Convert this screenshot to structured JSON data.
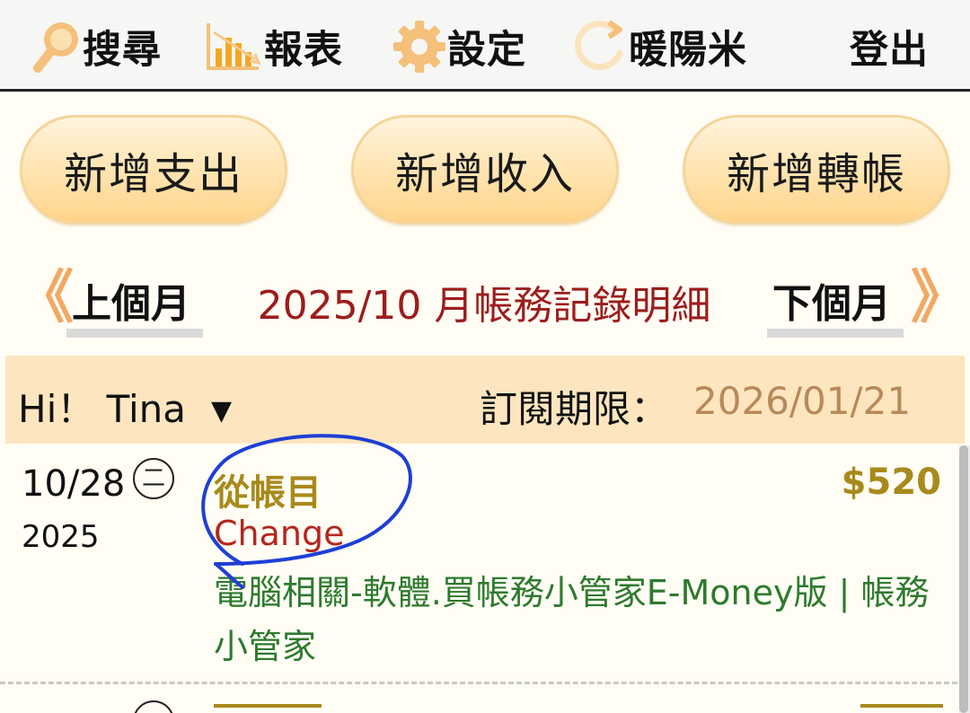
{
  "nav": {
    "search_label": "搜尋",
    "report_label": "報表",
    "settings_label": "設定",
    "sunrice_label": "暖陽米",
    "logout_label": "登出"
  },
  "actions": {
    "add_expense": "新增支出",
    "add_income": "新增收入",
    "add_transfer": "新增轉帳"
  },
  "month_nav": {
    "prev_chevron": "《",
    "prev_label": "上個月",
    "title": "2025/10 月帳務記錄明細",
    "next_label": "下個月",
    "next_chevron": "》"
  },
  "user": {
    "greeting": "Hi！ Tina",
    "caret": "▼",
    "subscription_label": "訂閱期限：",
    "subscription_date": "2026/01/21"
  },
  "records": [
    {
      "date": "10/28",
      "weekday": "二",
      "year": "2025",
      "account": "從帳目",
      "change": "Change",
      "amount": "$520",
      "description": "電腦相關-軟體.買帳務小管家E-Money版 | 帳務小管家"
    }
  ],
  "colors": {
    "accent_orange": "#f2a863",
    "title_red": "#9c1d1d",
    "account_gold": "#a88a1c",
    "change_red": "#b4271f",
    "desc_green": "#2e7a2e",
    "pen_blue": "#1e3fd6"
  },
  "icons": {
    "search": "magnifier-icon",
    "report": "bar-chart-icon",
    "settings": "gear-icon",
    "sunrice": "refresh-icon"
  }
}
